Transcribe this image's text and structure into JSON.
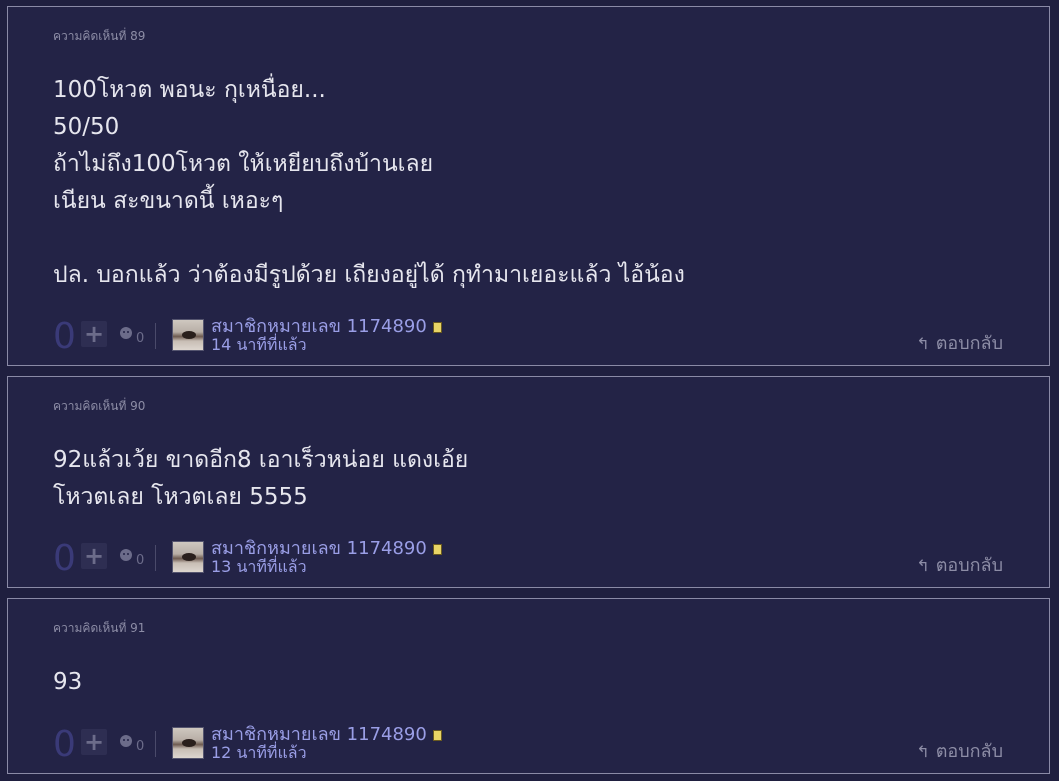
{
  "comments": [
    {
      "number_label": "ความคิดเห็นที่ 89",
      "body_lines": [
        "100โหวต พอนะ กุเหนื่อย...",
        "50/50",
        "ถ้าไม่ถึง100โหวต ให้เหยียบถึงบ้านเลย",
        "เนียน สะขนาดนี้ เหอะๆ",
        "",
        "ปล. บอกแล้ว ว่าต้องมีรูปด้วย เถียงอยู่ได้ กุทำมาเยอะแล้ว ไอ้น้อง"
      ],
      "vote_count": "0",
      "emotion_count": "0",
      "username": "สมาชิกหมายเลข 1174890",
      "timestamp": "14 นาทีที่แล้ว",
      "reply_label": "ตอบกลับ"
    },
    {
      "number_label": "ความคิดเห็นที่ 90",
      "body_lines": [
        "92แล้วเว้ย ขาดอีก8 เอาเร็วหน่อย แดงเอ้ย",
        "โหวตเลย โหวตเลย 5555"
      ],
      "vote_count": "0",
      "emotion_count": "0",
      "username": "สมาชิกหมายเลข 1174890",
      "timestamp": "13 นาทีที่แล้ว",
      "reply_label": "ตอบกลับ"
    },
    {
      "number_label": "ความคิดเห็นที่ 91",
      "body_lines": [
        "93"
      ],
      "vote_count": "0",
      "emotion_count": "0",
      "username": "สมาชิกหมายเลข 1174890",
      "timestamp": "12 นาทีที่แล้ว",
      "reply_label": "ตอบกลับ"
    }
  ],
  "icons": {
    "plus": "plus-icon",
    "emotion": "emotion-face-icon",
    "badge": "member-badge-icon",
    "reply": "reply-arrow-icon"
  }
}
